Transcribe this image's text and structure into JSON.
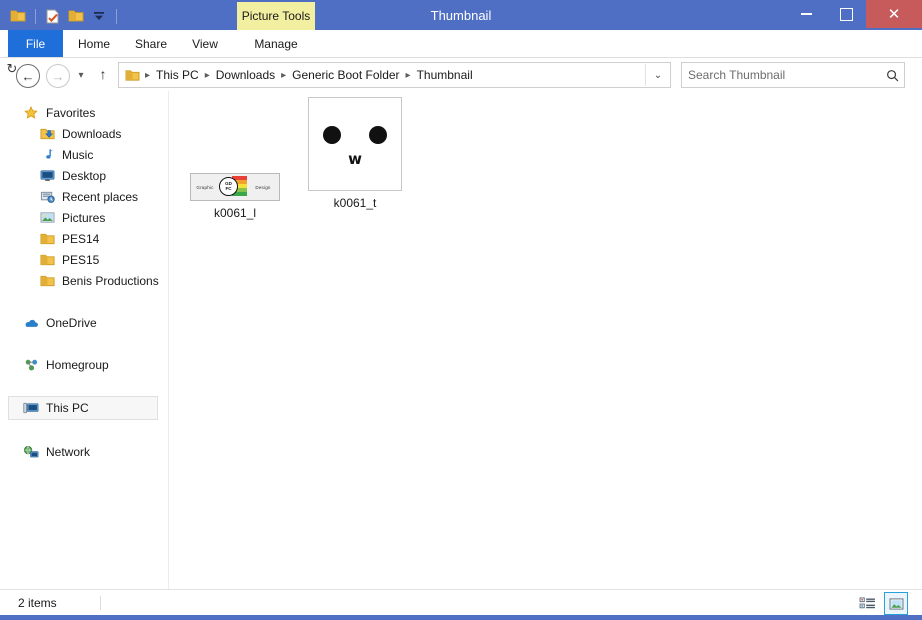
{
  "window": {
    "title": "Thumbnail",
    "contextual_tab": "Picture Tools",
    "controls": {
      "minimize": "–",
      "maximize": "□",
      "close": "✕"
    },
    "quick_access": [
      {
        "name": "folder-icon",
        "tooltip": "Explorer"
      },
      {
        "name": "properties-icon",
        "tooltip": "Properties"
      },
      {
        "name": "new-folder-icon",
        "tooltip": "New folder"
      },
      {
        "name": "customize-dropdown-icon",
        "glyph": "▾"
      }
    ]
  },
  "ribbon": {
    "tabs": [
      {
        "id": "file",
        "label": "File"
      },
      {
        "id": "home",
        "label": "Home"
      },
      {
        "id": "share",
        "label": "Share"
      },
      {
        "id": "view",
        "label": "View"
      },
      {
        "id": "manage",
        "label": "Manage"
      }
    ],
    "expand_glyph": "⌄",
    "help_glyph": "?"
  },
  "addressbar": {
    "back_glyph": "←",
    "forward_glyph": "→",
    "history_glyph": "▾",
    "up_glyph": "↑",
    "breadcrumb": [
      "This PC",
      "Downloads",
      "Generic Boot Folder",
      "Thumbnail"
    ],
    "separator": "▸",
    "dropdown_glyph": "⌄",
    "refresh_glyph": "↻"
  },
  "search": {
    "placeholder": "Search Thumbnail",
    "value": "",
    "icon_glyph": "⚲"
  },
  "sidebar": {
    "groups": [
      {
        "header": {
          "label": "Favorites",
          "icon": "star-icon"
        },
        "items": [
          {
            "label": "Downloads",
            "icon": "downloads-icon"
          },
          {
            "label": "Music",
            "icon": "music-icon"
          },
          {
            "label": "Desktop",
            "icon": "desktop-icon"
          },
          {
            "label": "Recent places",
            "icon": "recent-places-icon"
          },
          {
            "label": "Pictures",
            "icon": "pictures-icon"
          },
          {
            "label": "PES14",
            "icon": "folder-icon"
          },
          {
            "label": "PES15",
            "icon": "folder-icon"
          },
          {
            "label": "Benis Productions",
            "icon": "folder-icon"
          }
        ]
      }
    ],
    "roots": [
      {
        "label": "OneDrive",
        "icon": "onedrive-icon",
        "selected": false
      },
      {
        "label": "Homegroup",
        "icon": "homegroup-icon",
        "selected": false
      },
      {
        "label": "This PC",
        "icon": "this-pc-icon",
        "selected": true
      },
      {
        "label": "Network",
        "icon": "network-icon",
        "selected": false
      }
    ]
  },
  "files": [
    {
      "name": "k0061_l",
      "thumbnail_type": "graphic-design-banner",
      "thumb_text_left": "Graphic",
      "thumb_text_right": "Design",
      "emblem_line1": "GD",
      "emblem_line2": "FC",
      "bar_colors": [
        "#e8413a",
        "#f0a22e",
        "#f3e03c",
        "#86c44a",
        "#3aa84a"
      ]
    },
    {
      "name": "k0061_t",
      "thumbnail_type": "kawaii-face",
      "mouth_glyph": "w",
      "face_bg": "#ffffff",
      "feature_color": "#111111"
    }
  ],
  "statusbar": {
    "item_count": "2 items",
    "views": [
      {
        "id": "details-view",
        "label": "Details view",
        "active": false
      },
      {
        "id": "large-icons-view",
        "label": "Large icons view",
        "active": true
      }
    ]
  },
  "colors": {
    "titlebar": "#4f6fc4",
    "file_tab": "#1e6fd9",
    "close_button": "#c75b5b",
    "contextual_tab": "#f2f0a0",
    "accent_selection": "#2a9fd8"
  }
}
